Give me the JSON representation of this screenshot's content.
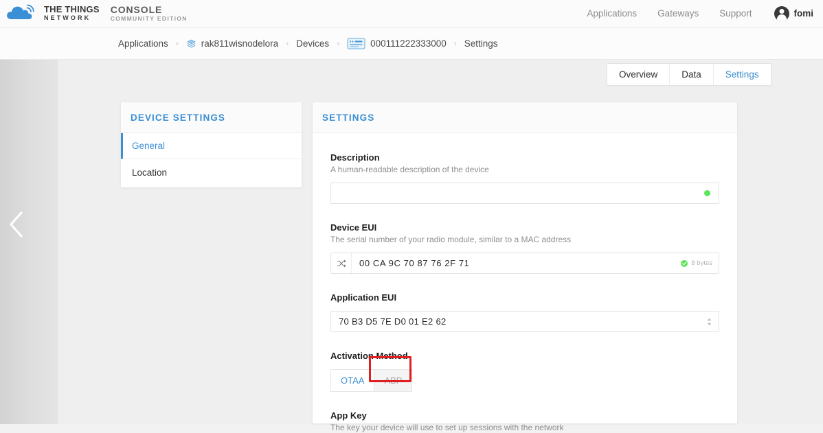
{
  "header": {
    "brand": {
      "logo_icon": "ttn-cloud-icon",
      "line1": "THE THINGS",
      "line2": "NETWORK",
      "console_line1": "CONSOLE",
      "console_line2": "COMMUNITY EDITION"
    },
    "nav": [
      {
        "label": "Applications",
        "name": "nav-applications"
      },
      {
        "label": "Gateways",
        "name": "nav-gateways"
      },
      {
        "label": "Support",
        "name": "nav-support"
      }
    ],
    "user": {
      "name": "fomi",
      "avatar_icon": "user-avatar-icon"
    }
  },
  "breadcrumb": {
    "items": [
      {
        "label": "Applications",
        "icon": null
      },
      {
        "label": "rak811wisnodelora",
        "icon": "application-stack-icon"
      },
      {
        "label": "Devices",
        "icon": null
      },
      {
        "label": "000111222333000",
        "icon": "device-card-icon"
      },
      {
        "label": "Settings",
        "icon": null
      }
    ],
    "separator": "›"
  },
  "back_button": {
    "icon": "chevron-left-icon"
  },
  "tabs": [
    {
      "label": "Overview",
      "active": false
    },
    {
      "label": "Data",
      "active": false
    },
    {
      "label": "Settings",
      "active": true
    }
  ],
  "sidebar": {
    "title": "DEVICE SETTINGS",
    "items": [
      {
        "label": "General",
        "active": true
      },
      {
        "label": "Location",
        "active": false
      }
    ]
  },
  "main": {
    "title": "SETTINGS",
    "fields": {
      "description": {
        "label": "Description",
        "hint": "A human-readable description of the device",
        "value": "",
        "placeholder": "",
        "status_icon": "green-dot-icon"
      },
      "device_eui": {
        "label": "Device EUI",
        "hint": "The serial number of your radio module, similar to a MAC address",
        "value": "00 CA 9C 70 87 76 2F 71",
        "left_icon": "shuffle-icon",
        "byte_status": "8 bytes",
        "byte_status_icon": "green-check-icon"
      },
      "application_eui": {
        "label": "Application EUI",
        "hint": "",
        "value": "70 B3 D5 7E D0 01 E2 62",
        "dropdown_icon": "chevron-updown-icon",
        "options": [
          "70 B3 D5 7E D0 01 E2 62"
        ]
      },
      "activation_method": {
        "label": "Activation Method",
        "options": [
          {
            "label": "OTAA",
            "selected": true
          },
          {
            "label": "ABP",
            "selected": false
          }
        ],
        "highlighted_option": "ABP"
      },
      "app_key": {
        "label": "App Key",
        "hint": "The key your device will use to set up sessions with the network"
      }
    }
  },
  "colors": {
    "accent_blue": "#3b8fd4",
    "status_green": "#5ce65c",
    "annotation_red": "#e02020",
    "page_bg": "#efefef"
  }
}
